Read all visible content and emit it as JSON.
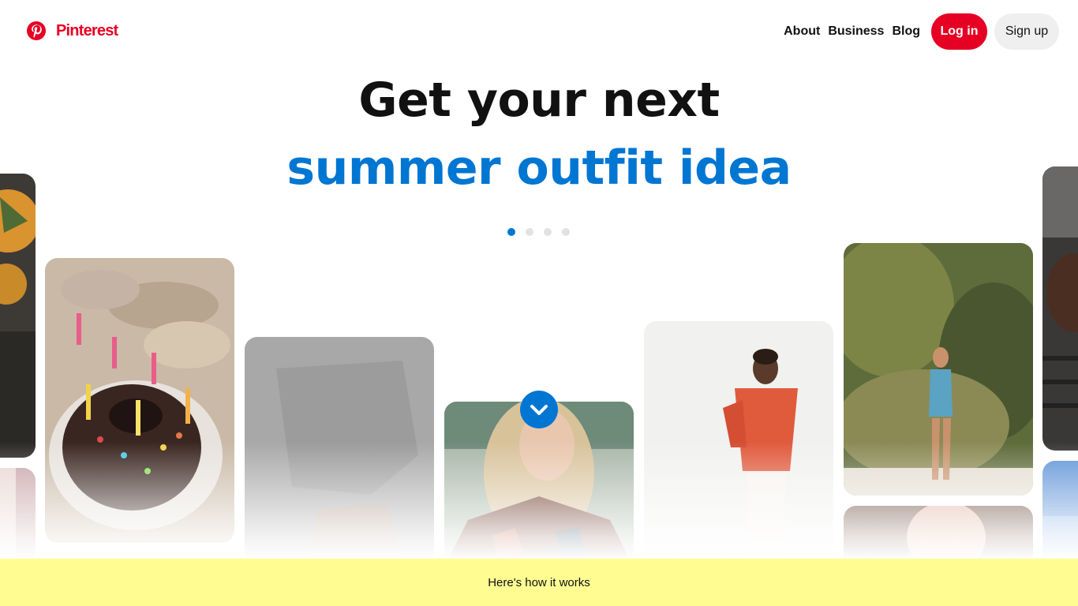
{
  "brand": {
    "name": "Pinterest",
    "color": "#e60023",
    "icon": "pinterest-logo-icon"
  },
  "nav": {
    "about": "About",
    "business": "Business",
    "blog": "Blog",
    "login": "Log in",
    "signup": "Sign up"
  },
  "hero": {
    "line1": "Get your next",
    "line2": "summer outfit idea",
    "accent_color": "#0076d3"
  },
  "carousel": {
    "slide_count": 4,
    "active_index": 0
  },
  "pins": [
    {
      "name": "pin-food-left"
    },
    {
      "name": "pin-birthday-cake"
    },
    {
      "name": "pin-dark-outfit"
    },
    {
      "name": "pin-blonde-woman"
    },
    {
      "name": "pin-red-shirt-woman"
    },
    {
      "name": "pin-swimsuit-woman"
    },
    {
      "name": "pin-portrait-woman"
    },
    {
      "name": "pin-grill-right"
    },
    {
      "name": "pin-sky-right"
    }
  ],
  "scroll_button": {
    "icon": "chevron-down-icon",
    "color": "#0076d3"
  },
  "how_it_works": {
    "label": "Here's how it works",
    "background": "#fffd92"
  }
}
